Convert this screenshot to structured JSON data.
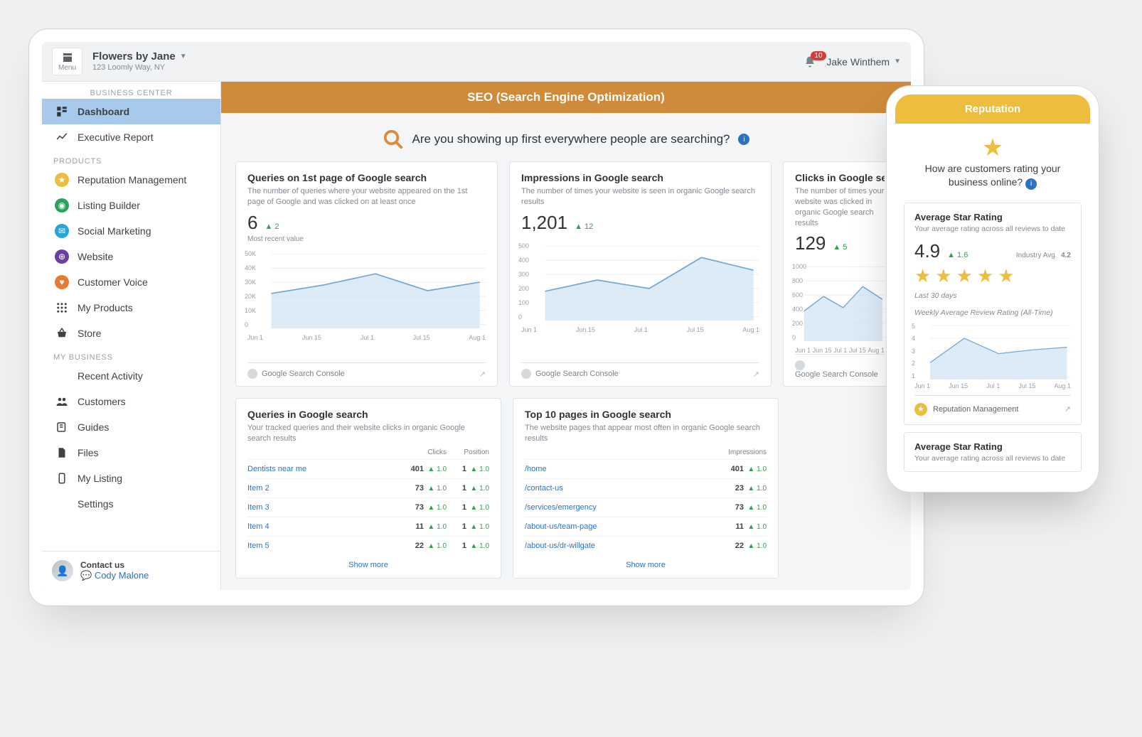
{
  "topbar": {
    "menu_label": "Menu",
    "business_name": "Flowers by Jane",
    "business_addr": "123 Loomly Way, NY",
    "notification_count": "10",
    "user_name": "Jake Winthem"
  },
  "sidebar": {
    "center_label": "BUSINESS CENTER",
    "items_main": [
      {
        "label": "Dashboard"
      },
      {
        "label": "Executive Report"
      }
    ],
    "products_label": "PRODUCTS",
    "items_products": [
      {
        "label": "Reputation Management"
      },
      {
        "label": "Listing Builder"
      },
      {
        "label": "Social Marketing"
      },
      {
        "label": "Website"
      },
      {
        "label": "Customer Voice"
      },
      {
        "label": "My Products"
      },
      {
        "label": "Store"
      }
    ],
    "mybiz_label": "MY BUSINESS",
    "items_mybiz": [
      {
        "label": "Recent Activity"
      },
      {
        "label": "Customers"
      },
      {
        "label": "Guides"
      },
      {
        "label": "Files"
      },
      {
        "label": "My Listing"
      },
      {
        "label": "Settings"
      }
    ],
    "contact_label": "Contact us",
    "contact_name": "Cody Malone"
  },
  "main": {
    "banner": "SEO (Search Engine Optimization)",
    "headline": "Are you showing up first everywhere people are searching?",
    "cards": [
      {
        "title": "Queries on 1st page of Google search",
        "sub": "The number of queries where your website appeared on the 1st page of Google and was clicked on at least once",
        "value": "6",
        "delta": "2",
        "note": "Most recent value",
        "foot": "Google Search Console"
      },
      {
        "title": "Impressions in Google search",
        "sub": "The number of times your website is seen in organic Google search results",
        "value": "1,201",
        "delta": "12",
        "note": "",
        "foot": "Google Search Console"
      },
      {
        "title": "Clicks in Google search",
        "sub": "The number of times your website was clicked in organic Google search results",
        "value": "129",
        "delta": "5",
        "note": "",
        "foot": "Google Search Console"
      }
    ],
    "xticks": [
      "Jun 1",
      "Jun 15",
      "Jul 1",
      "Jul 15",
      "Aug 1"
    ],
    "table_cards": [
      {
        "title": "Queries in Google search",
        "sub": "Your tracked queries and their website clicks in organic Google search results",
        "col1": "Clicks",
        "col2": "Position",
        "rows": [
          {
            "name": "Dentists near me",
            "v1": "401",
            "d1": "1.0",
            "v2": "1",
            "d2": "1.0"
          },
          {
            "name": "Item 2",
            "v1": "73",
            "d1": "1.0",
            "v2": "1",
            "d2": "1.0"
          },
          {
            "name": "Item 3",
            "v1": "73",
            "d1": "1.0",
            "v2": "1",
            "d2": "1.0"
          },
          {
            "name": "Item 4",
            "v1": "11",
            "d1": "1.0",
            "v2": "1",
            "d2": "1.0"
          },
          {
            "name": "Item 5",
            "v1": "22",
            "d1": "1.0",
            "v2": "1",
            "d2": "1.0"
          }
        ],
        "show_more": "Show more"
      },
      {
        "title": "Top 10 pages in Google search",
        "sub": "The website pages that appear most often in organic Google search results",
        "col_single": "Impressions",
        "rows": [
          {
            "name": "/home",
            "v1": "401",
            "d1": "1.0"
          },
          {
            "name": "/contact-us",
            "v1": "23",
            "d1": "1.0"
          },
          {
            "name": "/services/emergency",
            "v1": "73",
            "d1": "1.0"
          },
          {
            "name": "/about-us/team-page",
            "v1": "11",
            "d1": "1.0"
          },
          {
            "name": "/about-us/dr-willgate",
            "v1": "22",
            "d1": "1.0"
          }
        ],
        "show_more": "Show more"
      }
    ]
  },
  "phone": {
    "banner": "Reputation",
    "headline": "How are customers rating your business online?",
    "card1": {
      "title": "Average Star Rating",
      "sub": "Your average rating across all reviews to date",
      "rating": "4.9",
      "delta": "1.6",
      "industry_label": "Industry Avg.",
      "industry_value": "4.2",
      "period": "Last 30 days",
      "chart_title": "Weekly Average Review Rating (All-Time)",
      "foot": "Reputation Management"
    },
    "card2": {
      "title": "Average Star Rating",
      "sub": "Your average rating across all reviews to date"
    },
    "xticks": [
      "Jun 1",
      "Jun 15",
      "Jul 1",
      "Jul 15",
      "Aug 1"
    ]
  },
  "chart_data": [
    {
      "type": "line",
      "title": "Queries on 1st page of Google search",
      "x": [
        "Jun 1",
        "Jun 15",
        "Jul 1",
        "Jul 15",
        "Aug 1"
      ],
      "values": [
        22000,
        28000,
        36000,
        24000,
        30000
      ],
      "ylim": [
        0,
        50000
      ],
      "yticks": [
        "0",
        "10K",
        "20K",
        "30K",
        "40K",
        "50K"
      ]
    },
    {
      "type": "line",
      "title": "Impressions in Google search",
      "x": [
        "Jun 1",
        "Jun 15",
        "Jul 1",
        "Jul 15",
        "Aug 1"
      ],
      "values": [
        180,
        260,
        200,
        420,
        330
      ],
      "ylim": [
        0,
        500
      ],
      "yticks": [
        "0",
        "100",
        "200",
        "300",
        "400",
        "500"
      ]
    },
    {
      "type": "line",
      "title": "Clicks in Google search",
      "x": [
        "Jun 1",
        "Jun 15",
        "Jul 1",
        "Jul 15",
        "Aug 1"
      ],
      "values": [
        370,
        580,
        420,
        720,
        540
      ],
      "ylim": [
        0,
        1000
      ],
      "yticks": [
        "0",
        "200",
        "400",
        "600",
        "800",
        "1000"
      ]
    },
    {
      "type": "line",
      "title": "Weekly Average Review Rating (All-Time)",
      "x": [
        "Jun 1",
        "Jun 15",
        "Jul 1",
        "Jul 15",
        "Aug 1"
      ],
      "values": [
        2.1,
        4.0,
        2.8,
        3.1,
        3.3
      ],
      "ylim": [
        1,
        5
      ],
      "yticks": [
        "1",
        "2",
        "3",
        "4",
        "5"
      ]
    }
  ]
}
